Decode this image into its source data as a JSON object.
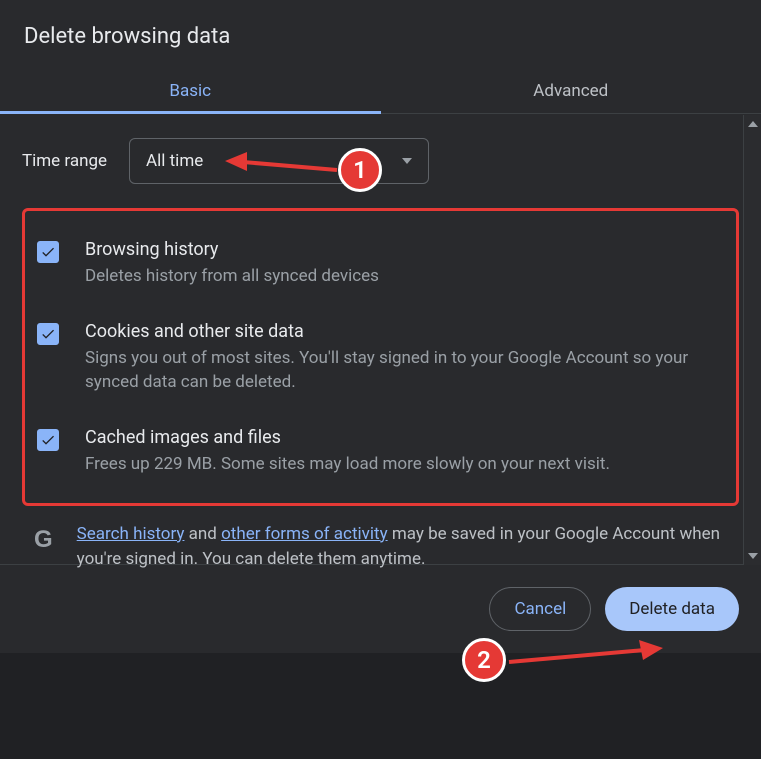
{
  "dialog": {
    "title": "Delete browsing data",
    "tabs": {
      "basic": "Basic",
      "advanced": "Advanced"
    },
    "time_range": {
      "label": "Time range",
      "value": "All time"
    },
    "options": [
      {
        "title": "Browsing history",
        "desc": "Deletes history from all synced devices"
      },
      {
        "title": "Cookies and other site data",
        "desc": "Signs you out of most sites. You'll stay signed in to your Google Account so your synced data can be deleted."
      },
      {
        "title": "Cached images and files",
        "desc": "Frees up 229 MB. Some sites may load more slowly on your next visit."
      }
    ],
    "info": {
      "link1": "Search history",
      "mid1": " and ",
      "link2": "other forms of activity",
      "rest": " may be saved in your Google Account when you're signed in. You can delete them anytime."
    },
    "buttons": {
      "cancel": "Cancel",
      "confirm": "Delete data"
    }
  },
  "annotations": {
    "one": "1",
    "two": "2"
  }
}
